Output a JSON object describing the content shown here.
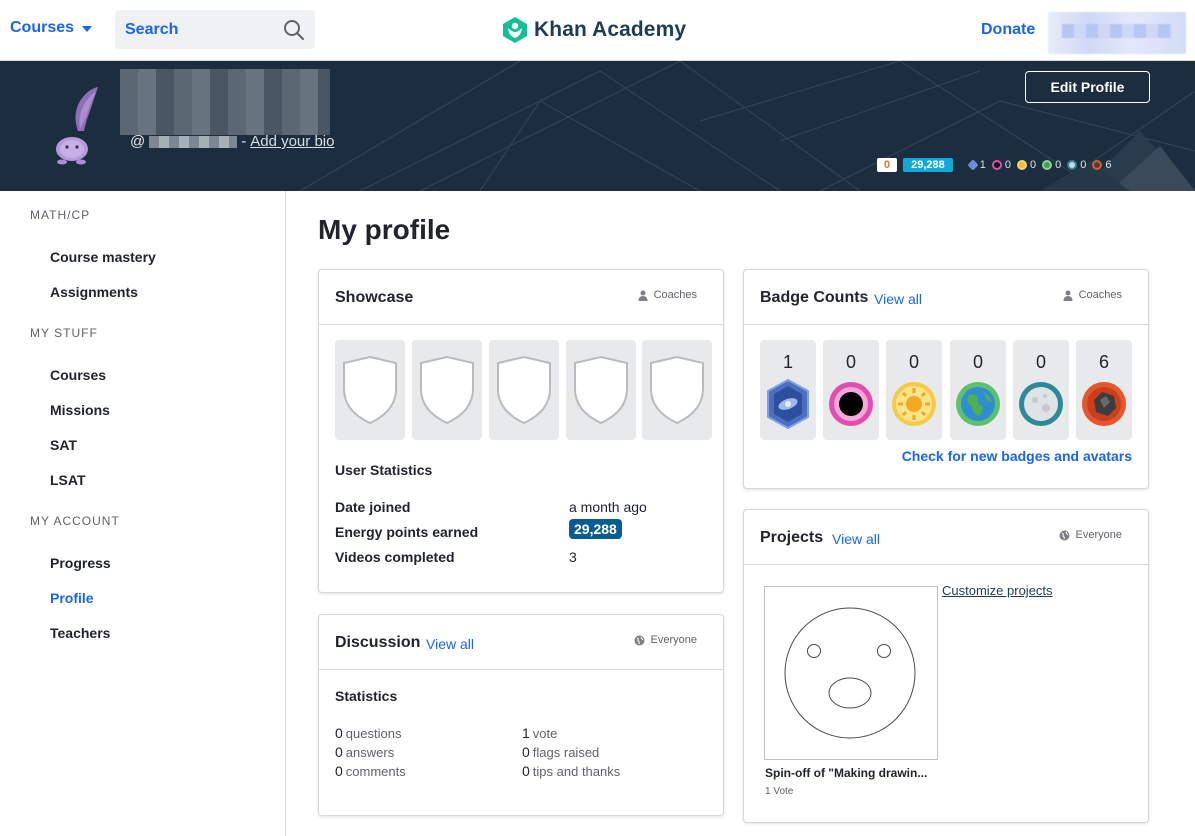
{
  "topnav": {
    "courses_label": "Courses",
    "search_placeholder": "Search",
    "logo_text": "Khan Academy",
    "donate_label": "Donate"
  },
  "banner": {
    "username_prefix": "@",
    "username_separator": "-",
    "add_bio_label": "Add your bio",
    "edit_profile_label": "Edit Profile",
    "streak": "0",
    "energy_points": "29,288",
    "badge_counts": [
      "1",
      "0",
      "0",
      "0",
      "0",
      "6"
    ]
  },
  "sidebar": {
    "sections": [
      {
        "title": "MATH/CP",
        "items": [
          "Course mastery",
          "Assignments"
        ]
      },
      {
        "title": "MY STUFF",
        "items": [
          "Courses",
          "Missions",
          "SAT",
          "LSAT"
        ]
      },
      {
        "title": "MY ACCOUNT",
        "items": [
          "Progress",
          "Profile",
          "Teachers"
        ]
      }
    ],
    "active_item": "Profile"
  },
  "main": {
    "page_title": "My profile",
    "showcase": {
      "title": "Showcase",
      "visibility": "Coaches",
      "user_stats_title": "User Statistics",
      "stats": [
        {
          "label": "Date joined",
          "value": "a month ago"
        },
        {
          "label": "Energy points earned",
          "value": "29,288"
        },
        {
          "label": "Videos completed",
          "value": "3"
        }
      ]
    },
    "badge_counts": {
      "title": "Badge Counts",
      "view_all": "View all",
      "visibility": "Coaches",
      "counts": [
        "1",
        "0",
        "0",
        "0",
        "0",
        "6"
      ],
      "check_link": "Check for new badges and avatars"
    },
    "discussion": {
      "title": "Discussion",
      "view_all": "View all",
      "visibility": "Everyone",
      "statistics_title": "Statistics",
      "left": [
        {
          "count": "0",
          "label": "questions"
        },
        {
          "count": "0",
          "label": "answers"
        },
        {
          "count": "0",
          "label": "comments"
        }
      ],
      "right": [
        {
          "count": "1",
          "label": "vote"
        },
        {
          "count": "0",
          "label": "flags raised"
        },
        {
          "count": "0",
          "label": "tips and thanks"
        }
      ]
    },
    "projects": {
      "title": "Projects",
      "view_all": "View all",
      "visibility": "Everyone",
      "customize_link": "Customize projects",
      "project_title": "Spin-off of \"Making drawin...",
      "project_votes": "1 Vote"
    }
  }
}
